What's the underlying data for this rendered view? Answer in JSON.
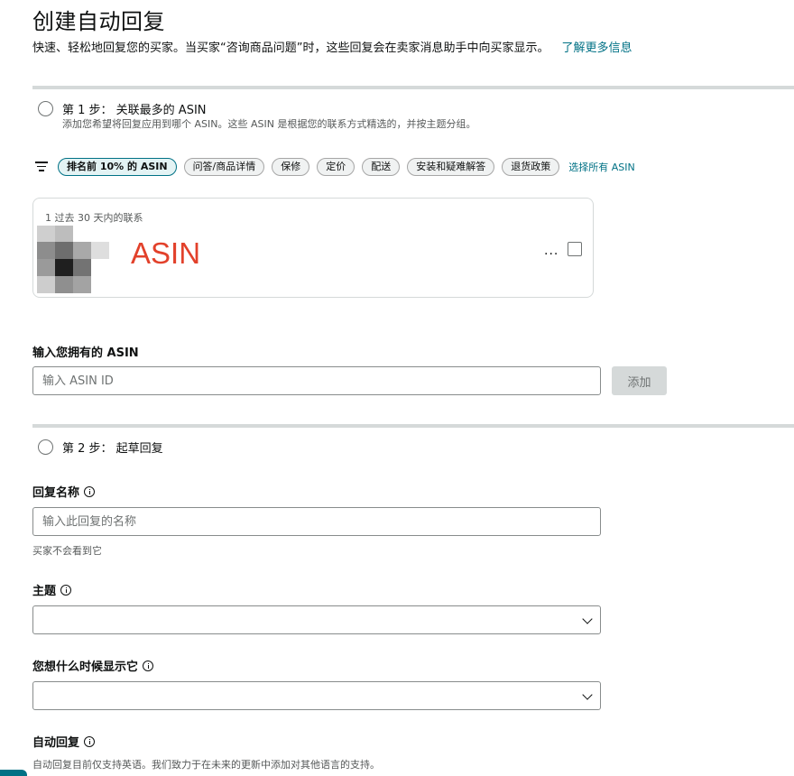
{
  "header": {
    "title": "创建自动回复",
    "subtitle": "快速、轻松地回复您的买家。当买家“咨询商品问题”时，这些回复会在卖家消息助手中向买家显示。",
    "learn_more": "了解更多信息"
  },
  "step1": {
    "title": "第 1 步： 关联最多的 ASIN",
    "description": "添加您希望将回复应用到哪个 ASIN。这些 ASIN 是根据您的联系方式精选的，并按主题分组。"
  },
  "filters": {
    "chips": [
      "排名前 10% 的 ASIN",
      "问答/商品详情",
      "保修",
      "定价",
      "配送",
      "安装和疑难解答",
      "退货政策"
    ],
    "select_all": "选择所有 ASIN"
  },
  "asin_card": {
    "caption": "1 过去 30 天内的联系",
    "name": "ASIN",
    "more": "...",
    "checked": false
  },
  "own_asin": {
    "label": "输入您拥有的 ASIN",
    "placeholder": "输入 ASIN ID",
    "value": "",
    "add_button": "添加"
  },
  "step2": {
    "title": "第 2 步： 起草回复"
  },
  "reply_name": {
    "label": "回复名称",
    "placeholder": "输入此回复的名称",
    "hint": "买家不会看到它"
  },
  "topic": {
    "label": "主题",
    "selected": ""
  },
  "when_show": {
    "label": "您想什么时候显示它",
    "selected": ""
  },
  "auto_reply": {
    "label": "自动回复",
    "hint": "自动回复目前仅支持英语。我们致力于在未来的更新中添加对其他语言的支持。"
  },
  "colors": {
    "link": "#007185",
    "asin_red": "#e2412b",
    "divider": "#d5d9d9"
  }
}
